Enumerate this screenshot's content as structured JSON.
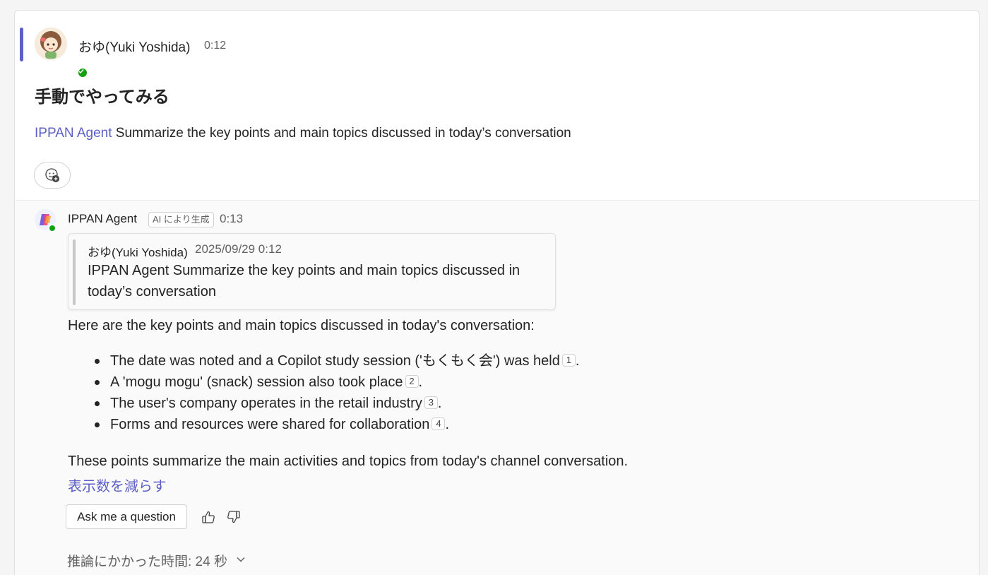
{
  "post": {
    "author": "おゆ(Yuki Yoshida)",
    "time": "0:12",
    "subject": "手動でやってみる",
    "mention": "IPPAN Agent",
    "message": " Summarize the key points and main topics discussed in today’s conversation"
  },
  "reply": {
    "agent_name": "IPPAN Agent",
    "ai_badge": "AI により生成",
    "time": "0:13",
    "quote": {
      "author": "おゆ(Yuki Yoshida)",
      "date": "2025/09/29 0:12",
      "text": "IPPAN Agent Summarize the key points and main topics discussed in today’s conversation"
    },
    "intro": "Here are the key points and main topics discussed in today's conversation:",
    "bullets": [
      {
        "text": "The date was noted and a Copilot study session ('もくもく会') was held",
        "cite": "1"
      },
      {
        "text": "A 'mogu mogu' (snack) session also took place",
        "cite": "2"
      },
      {
        "text": "The user's company operates in the retail industry",
        "cite": "3"
      },
      {
        "text": "Forms and resources were shared for collaboration",
        "cite": "4"
      }
    ],
    "closing": "These points summarize the main activities and topics from today's channel conversation.",
    "show_less": "表示数を減らす",
    "ask_button": "Ask me a question",
    "reasoning_time": "推論にかかった時間: 24 秒"
  },
  "colors": {
    "accent": "#5b5fc7",
    "presence": "#13a10e"
  },
  "icons": [
    "add-reaction-icon",
    "thumbs-up-icon",
    "thumbs-down-icon",
    "chevron-down-icon",
    "copilot-agent-icon"
  ]
}
